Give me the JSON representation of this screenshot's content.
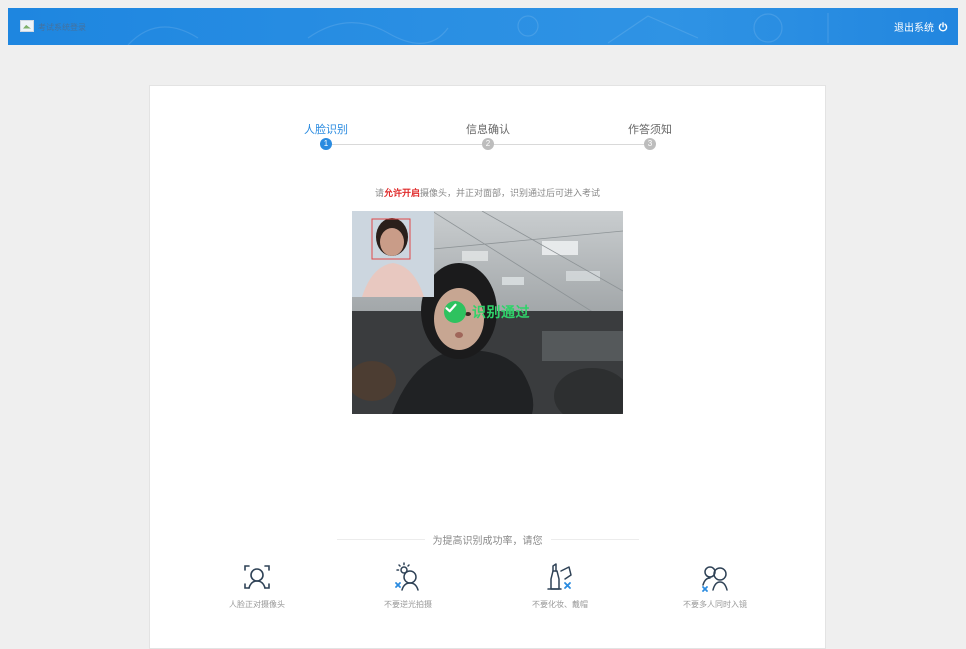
{
  "header": {
    "logo_alt": "考试系统登录",
    "logout_label": "退出系统",
    "logout_icon": "power-icon",
    "bg_color": "#2a8fe3"
  },
  "steps": [
    {
      "label": "人脸识别",
      "number": "1",
      "state": "active"
    },
    {
      "label": "信息确认",
      "number": "2",
      "state": "pending"
    },
    {
      "label": "作答须知",
      "number": "3",
      "state": "pending"
    }
  ],
  "hint": {
    "prefix": "请",
    "emphasis": "允许开启",
    "suffix": "摄像头，并正对面部，识别通过后可进入考试"
  },
  "camera": {
    "status_text": "识别通过",
    "status_icon": "check-circle-icon",
    "status_color": "#2ec25f"
  },
  "tips": {
    "title": "为提高识别成功率，请您",
    "items": [
      {
        "label": "人脸正对摄像头",
        "icon": "face-frame-icon"
      },
      {
        "label": "不要逆光拍摄",
        "icon": "backlight-icon"
      },
      {
        "label": "不要化妆、戴帽",
        "icon": "no-makeup-icon"
      },
      {
        "label": "不要多人同时入镜",
        "icon": "multi-person-icon"
      }
    ]
  },
  "colors": {
    "accent": "#2a8be0",
    "emphasis": "#e02a2a",
    "pending": "#bdbdbd"
  }
}
